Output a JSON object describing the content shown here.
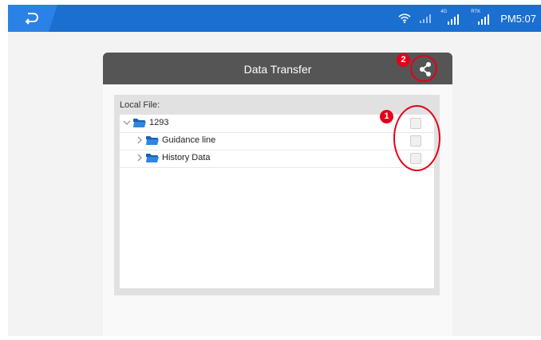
{
  "status_bar": {
    "time": "PM5:07",
    "icons": [
      "wifi-icon",
      "signal-weak-icon",
      "signal-4g-icon",
      "rtk-signal-icon"
    ],
    "signal_4g_tag": "4G",
    "rtk_tag": "RTK",
    "color": "#1a6fd0"
  },
  "dialog": {
    "title": "Data Transfer",
    "local_file_label": "Local File:",
    "tree": [
      {
        "label": "1293",
        "expanded": true,
        "level": 0
      },
      {
        "label": "Guidance line",
        "expanded": false,
        "level": 1
      },
      {
        "label": "History Data",
        "expanded": false,
        "level": 1
      }
    ]
  },
  "annotations": {
    "badge_1": "1",
    "badge_2": "2",
    "color": "#e3001b"
  }
}
